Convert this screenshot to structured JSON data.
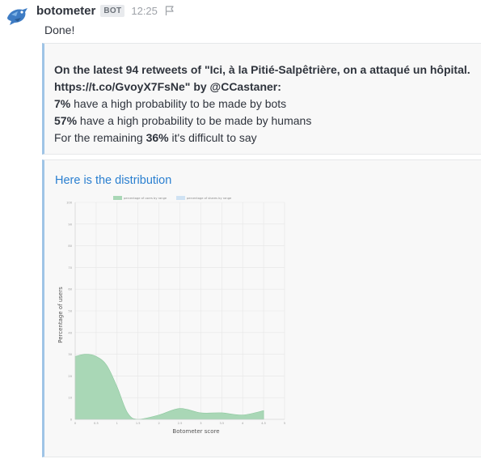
{
  "message": {
    "username": "botometer",
    "badge": "BOT",
    "time": "12:25",
    "text": "Done!",
    "avatar_icon": "bird-logo-icon",
    "flag_icon": "flag-icon"
  },
  "summary": {
    "line1": "On the latest 94 retweets of \"Ici, à la Pitié-Salpêtrière, on a attaqué un hôpital.",
    "line2": "https://t.co/GvoyX7FsNe\" by @CCastaner:",
    "bots_pct": "7%",
    "bots_text": " have a high probability to be made by bots",
    "humans_pct": "57%",
    "humans_text": " have a high probability to be made by humans",
    "remaining_prefix": "For the remaining ",
    "remaining_pct": "36%",
    "remaining_suffix": " it's difficult to say"
  },
  "distribution": {
    "title": "Here is the distribution"
  },
  "chart_data": {
    "type": "area",
    "xlabel": "Botometer score",
    "ylabel": "Percentage of users",
    "ylim": [
      0,
      100
    ],
    "xlim": [
      0,
      5
    ],
    "yticks": [
      "0",
      "10",
      "20",
      "30",
      "40",
      "50",
      "60",
      "70",
      "80",
      "90",
      "100"
    ],
    "xticks": [
      "0",
      "0.5",
      "1",
      "1.5",
      "2",
      "2.5",
      "3",
      "3.5",
      "4",
      "4.5",
      "5"
    ],
    "grid": true,
    "legend_position": "top",
    "series": [
      {
        "name": "percentage of users by range",
        "color": "#a9d7b6",
        "x": [
          0,
          0.25,
          0.5,
          0.75,
          1,
          1.25,
          1.5,
          2,
          2.5,
          3,
          3.5,
          4,
          4.5
        ],
        "values": [
          29,
          30,
          29,
          25,
          15,
          3,
          0,
          2,
          5,
          3,
          3,
          2,
          4
        ]
      },
      {
        "name": "percentage of shares by range",
        "color": "#cfe2f3",
        "x": [],
        "values": []
      }
    ]
  }
}
